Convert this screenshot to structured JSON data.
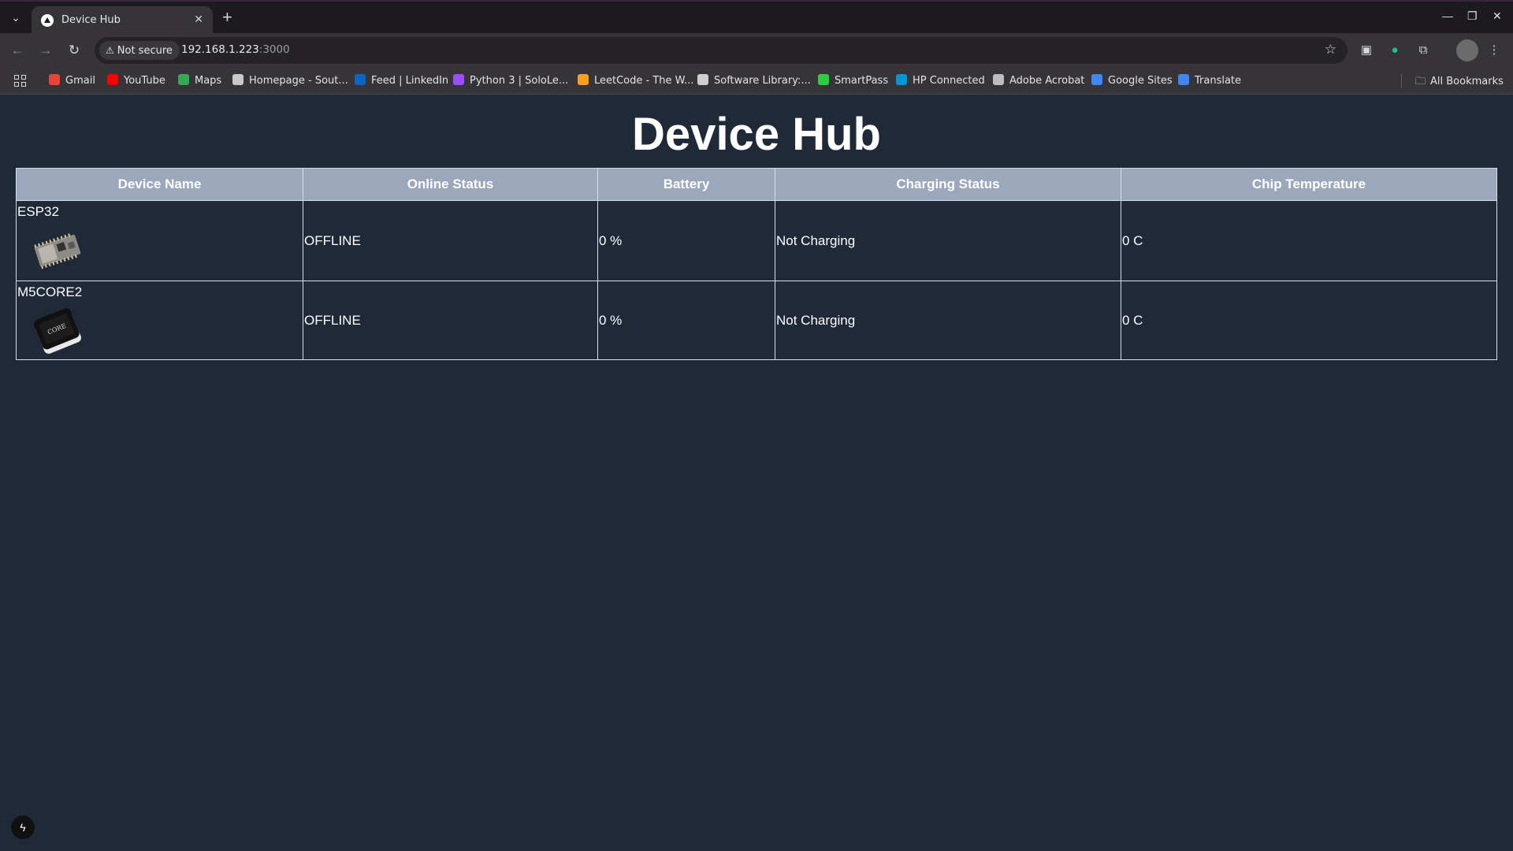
{
  "browser": {
    "tab_title": "Device Hub",
    "security_label": "Not secure",
    "url_host": "192.168.1.223",
    "url_port": ":3000",
    "bookmarks": [
      {
        "label": "Gmail",
        "color": "#ea4335"
      },
      {
        "label": "YouTube",
        "color": "#ff0000"
      },
      {
        "label": "Maps",
        "color": "#34a853"
      },
      {
        "label": "Homepage - Sout...",
        "color": "#c8c8c8"
      },
      {
        "label": "Feed | LinkedIn",
        "color": "#0a66c2"
      },
      {
        "label": "Python 3 | SoloLe...",
        "color": "#9b4dff"
      },
      {
        "label": "LeetCode - The W...",
        "color": "#f89f1b"
      },
      {
        "label": "Software Library:...",
        "color": "#cfcfcf"
      },
      {
        "label": "SmartPass",
        "color": "#2ecc40"
      },
      {
        "label": "HP Connected",
        "color": "#0096d6"
      },
      {
        "label": "Adobe Acrobat",
        "color": "#bdbdbd"
      },
      {
        "label": "Google Sites",
        "color": "#4285f4"
      },
      {
        "label": "Translate",
        "color": "#4285f4"
      }
    ],
    "all_bookmarks_label": "All Bookmarks"
  },
  "page": {
    "title": "Device Hub",
    "table": {
      "headers": [
        "Device Name",
        "Online Status",
        "Battery",
        "Charging Status",
        "Chip Temperature"
      ],
      "rows": [
        {
          "name": "ESP32",
          "image_icon": "esp32-board",
          "status": "OFFLINE",
          "battery": "0 %",
          "charging": "Not Charging",
          "temperature": "0 C"
        },
        {
          "name": "M5CORE2",
          "image_icon": "m5core2-device",
          "image_text": "CORE",
          "status": "OFFLINE",
          "battery": "0 %",
          "charging": "Not Charging",
          "temperature": "0 C"
        }
      ]
    }
  },
  "colors": {
    "page_bg": "#1f2937",
    "header_bg": "#9ba7ba",
    "border": "#d8dde5"
  }
}
